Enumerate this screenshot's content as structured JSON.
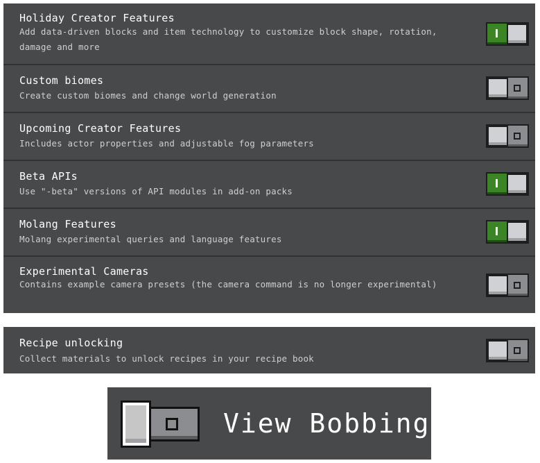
{
  "experiments": [
    {
      "title": "Holiday Creator Features",
      "description": "Add data-driven blocks and item technology to customize block shape, rotation, damage and more",
      "enabled": true
    },
    {
      "title": "Custom biomes",
      "description": "Create custom biomes and change world generation",
      "enabled": false
    },
    {
      "title": "Upcoming Creator Features",
      "description": "Includes actor properties and adjustable fog parameters",
      "enabled": false
    },
    {
      "title": "Beta APIs",
      "description": "Use \"-beta\" versions of API modules in add-on packs",
      "enabled": true
    },
    {
      "title": "Molang Features",
      "description": "Molang experimental queries and language features",
      "enabled": true
    },
    {
      "title": "Experimental Cameras",
      "description": "Contains example camera presets (the camera command is no longer experimental)",
      "enabled": false
    }
  ],
  "recipe_unlocking": {
    "title": "Recipe unlocking",
    "description": "Collect materials to unlock recipes in your recipe book",
    "enabled": false
  },
  "view_bobbing": {
    "label": "View Bobbing",
    "enabled": false
  },
  "colors": {
    "panel": "#48494a",
    "toggle_on": "#3c8527",
    "toggle_off": "#8c8d90",
    "knob": "#d0d1d4"
  }
}
